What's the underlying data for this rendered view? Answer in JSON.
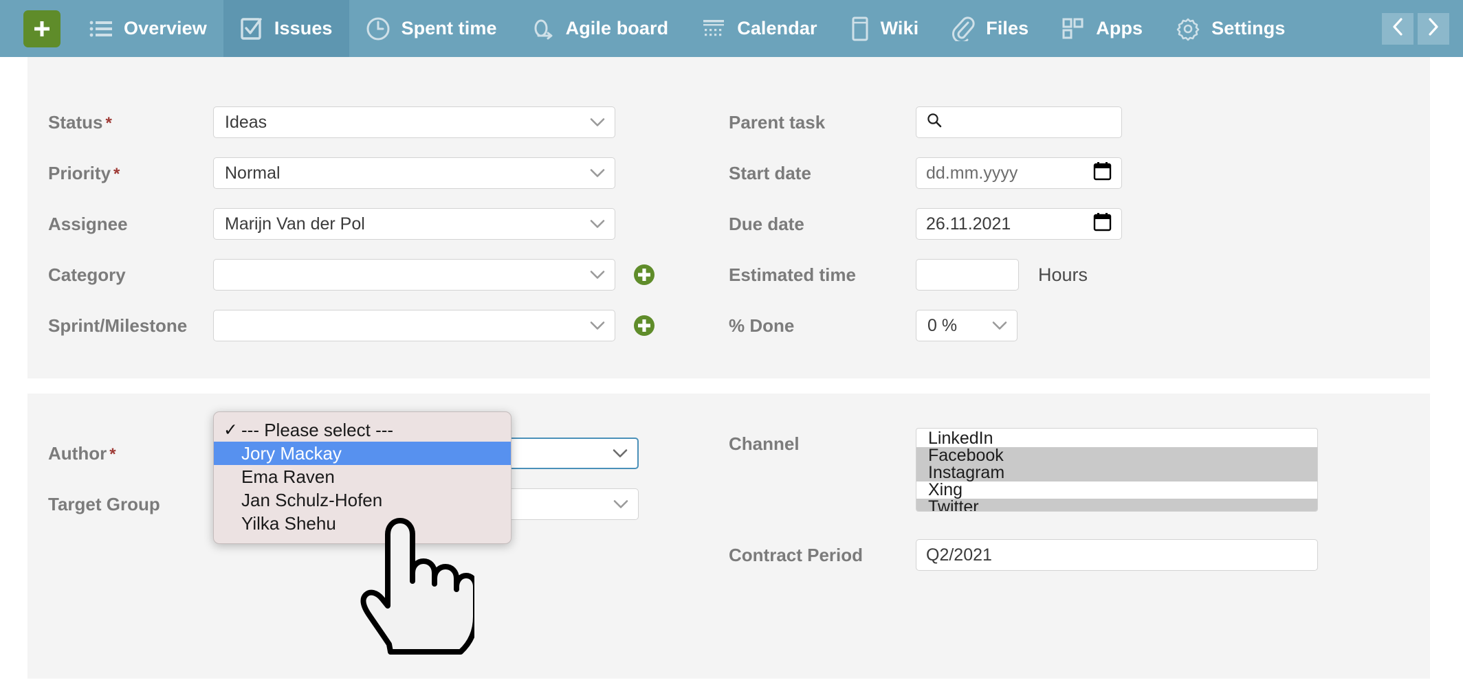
{
  "nav": {
    "add_button": "+",
    "items": [
      {
        "label": "Overview",
        "icon": "list-icon",
        "active": false
      },
      {
        "label": "Issues",
        "icon": "checkbox-task-icon",
        "active": true
      },
      {
        "label": "Spent time",
        "icon": "clock-icon",
        "active": false
      },
      {
        "label": "Agile board",
        "icon": "agile-refresh-icon",
        "active": false
      },
      {
        "label": "Calendar",
        "icon": "calendar-icon",
        "active": false
      },
      {
        "label": "Wiki",
        "icon": "book-icon",
        "active": false
      },
      {
        "label": "Files",
        "icon": "paperclip-icon",
        "active": false
      },
      {
        "label": "Apps",
        "icon": "apps-grid-icon",
        "active": false
      },
      {
        "label": "Settings",
        "icon": "gear-icon",
        "active": false
      }
    ],
    "prev_arrow": "‹",
    "next_arrow": "›"
  },
  "colors": {
    "nav_bg": "#6ca3bb",
    "nav_active": "#5e96b0",
    "add_green": "#5f8c2a",
    "panel_bg": "#f4f4f4",
    "required_red": "#9e3a35",
    "popup_bg": "#ece2e2",
    "popup_highlight": "#5791ef",
    "multiselect_selected": "#c9c9c9",
    "focus_blue": "#4a90b9"
  },
  "form": {
    "section1": {
      "left": [
        {
          "label": "Status",
          "required": true,
          "control": "select",
          "value": "Ideas",
          "addable": false
        },
        {
          "label": "Priority",
          "required": true,
          "control": "select",
          "value": "Normal",
          "addable": false
        },
        {
          "label": "Assignee",
          "required": false,
          "control": "select",
          "value": "Marijn Van der Pol",
          "addable": false
        },
        {
          "label": "Category",
          "required": false,
          "control": "select",
          "value": "",
          "addable": true
        },
        {
          "label": "Sprint/Milestone",
          "required": false,
          "control": "select",
          "value": "",
          "addable": true
        }
      ],
      "right": [
        {
          "label": "Parent task",
          "required": false,
          "control": "search",
          "value": "",
          "suffix": ""
        },
        {
          "label": "Start date",
          "required": false,
          "control": "date",
          "value": "dd.mm.yyyy",
          "is_placeholder": true,
          "suffix": ""
        },
        {
          "label": "Due date",
          "required": false,
          "control": "date",
          "value": "26.11.2021",
          "is_placeholder": false,
          "suffix": ""
        },
        {
          "label": "Estimated time",
          "required": false,
          "control": "text",
          "value": "",
          "suffix": "Hours"
        },
        {
          "label": "% Done",
          "required": false,
          "control": "select-small",
          "value": "0 %",
          "suffix": ""
        }
      ]
    },
    "section2": {
      "left": [
        {
          "label": "Author",
          "required": true,
          "control": "select-open",
          "value": ""
        },
        {
          "label": "Target Group",
          "required": false,
          "control": "select",
          "value": ""
        }
      ],
      "right": [
        {
          "label": "Channel",
          "required": false,
          "control": "multiselect"
        },
        {
          "label": "Contract Period",
          "required": false,
          "control": "text",
          "value": "Q2/2021"
        }
      ]
    }
  },
  "author_dropdown": {
    "options": [
      {
        "label": "--- Please select ---",
        "checked": true,
        "highlighted": false
      },
      {
        "label": "Jory Mackay",
        "checked": false,
        "highlighted": true
      },
      {
        "label": "Ema Raven",
        "checked": false,
        "highlighted": false
      },
      {
        "label": "Jan Schulz-Hofen",
        "checked": false,
        "highlighted": false
      },
      {
        "label": "Yilka Shehu",
        "checked": false,
        "highlighted": false
      }
    ],
    "check_glyph": "✓"
  },
  "channel_options": [
    {
      "label": "LinkedIn",
      "selected": false
    },
    {
      "label": "Facebook",
      "selected": true
    },
    {
      "label": "Instagram",
      "selected": true
    },
    {
      "label": "Xing",
      "selected": false
    },
    {
      "label": "Twitter",
      "selected": true
    }
  ]
}
